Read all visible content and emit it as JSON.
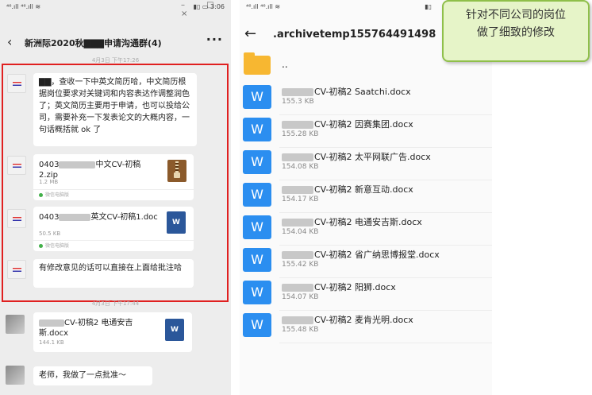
{
  "left_phone": {
    "status_time": "3:06",
    "status_left": "⁴⁶.ıll ⁴⁶.ıll ≋",
    "status_right": "▮▯ ▭ 3:06",
    "chat_title": "新洲际2020秋▇▇▇申请沟通群(4)",
    "more": "···",
    "timestamp_1": "4月3日 下午17:26",
    "timestamp_2": "4月3日 下午17:44",
    "messages": [
      {
        "type": "text",
        "text": "▇▇，查收一下中英文简历哈，中文简历根据岗位要求对关键词和内容表达作调整润色了；英文简历主要用于申请，也可以投给公司，需要补充一下发表论文的大概内容，一句话概括就 ok 了"
      },
      {
        "type": "file",
        "name_prefix": "0403",
        "name_suffix": "中文CV-初稿2.zip",
        "size": "1.2 MB",
        "source": "微信电脑版",
        "icon": "zip-icon"
      },
      {
        "type": "file",
        "name_prefix": "0403",
        "name_suffix": "英文CV-初稿1.doc",
        "size": "50.5 KB",
        "source": "微信电脑版",
        "icon": "word-doc-icon"
      },
      {
        "type": "text",
        "text": "有修改意见的话可以直接在上面给批注哈"
      },
      {
        "type": "file",
        "name_prefix": "",
        "name_suffix": "CV-初稿2 电通安吉斯.docx",
        "size": "144.1 KB",
        "source": "",
        "icon": "word-doc-icon"
      },
      {
        "type": "text",
        "text": "老师，我做了一点批准～"
      }
    ]
  },
  "right_phone": {
    "status_left": "⁴⁶.ıll ⁴⁶.ıll ≋",
    "status_right": "▮▯",
    "path": ".archivetemp155764491498",
    "parent_folder": "..",
    "files": [
      {
        "name": "CV-初稿2 Saatchi.docx",
        "size": "155.3 KB"
      },
      {
        "name": "CV-初稿2 因赛集团.docx",
        "size": "155.28 KB"
      },
      {
        "name": "CV-初稿2 太平网联广告.docx",
        "size": "154.08 KB"
      },
      {
        "name": "CV-初稿2 新意互动.docx",
        "size": "154.17 KB"
      },
      {
        "name": "CV-初稿2 电通安吉斯.docx",
        "size": "154.04 KB"
      },
      {
        "name": "CV-初稿2 省广纳思博报堂.docx",
        "size": "155.42 KB"
      },
      {
        "name": "CV-初稿2 阳狮.docx",
        "size": "154.07 KB"
      },
      {
        "name": "CV-初稿2 麦肯光明.docx",
        "size": "155.48 KB"
      }
    ],
    "word_icon_letter": "W"
  },
  "callout": {
    "line1": "针对不同公司的岗位",
    "line2": "做了细致的修改"
  },
  "colors": {
    "highlight_border": "#e02020",
    "word_blue": "#2b8ef0",
    "folder_yellow": "#f7b731",
    "callout_bg": "#e6f4c8",
    "callout_border": "#8fbf4a"
  }
}
